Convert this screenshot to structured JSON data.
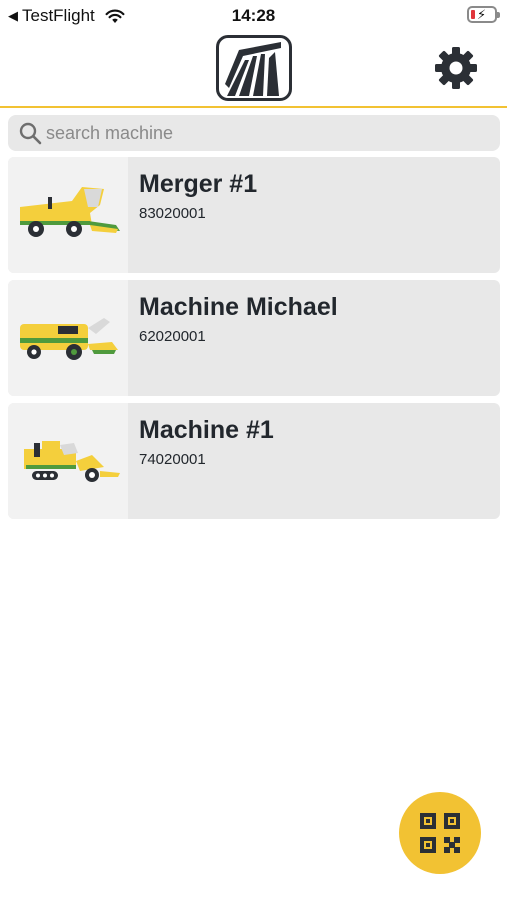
{
  "status_bar": {
    "back_label": "TestFlight",
    "time": "14:28"
  },
  "header": {
    "logo_icon": "brand-logo-icon",
    "settings_icon": "gear-icon"
  },
  "search": {
    "placeholder": "search machine",
    "value": ""
  },
  "machines": [
    {
      "name": "Merger #1",
      "serial": "83020001",
      "image": "merger-machine-icon"
    },
    {
      "name": "Machine Michael",
      "serial": "62020001",
      "image": "forage-harvester-icon"
    },
    {
      "name": "Machine #1",
      "serial": "74020001",
      "image": "tracked-harvester-icon"
    }
  ],
  "fab": {
    "icon": "qr-code-icon"
  },
  "colors": {
    "accent": "#f2c233",
    "machine_yellow": "#f4cf3c",
    "machine_green": "#4f9a3d",
    "card_bg": "#e8e8e8",
    "dark": "#2b2f35"
  }
}
